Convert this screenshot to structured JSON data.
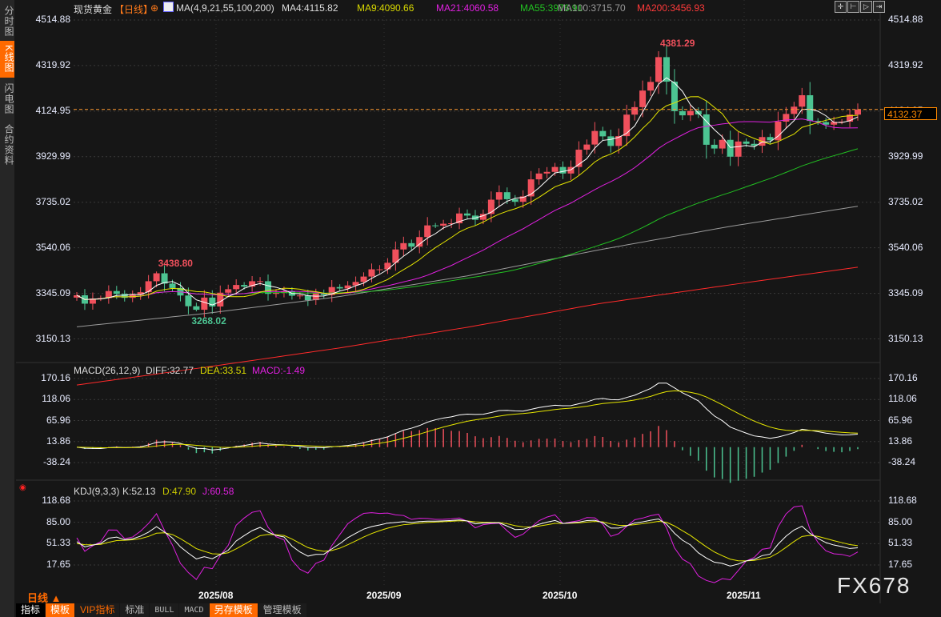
{
  "sidebar": {
    "items": [
      {
        "label": "分时图",
        "active": false
      },
      {
        "label": "K线图",
        "active": true
      },
      {
        "label": "闪电图",
        "active": false
      },
      {
        "label": "合约资料",
        "active": false
      }
    ]
  },
  "header": {
    "symbol": "现货黄金",
    "period": "【日线】",
    "ma_label": "MA(4,9,21,55,100,200)",
    "ma4": "MA4:4115.82",
    "ma9": "MA9:4090.66",
    "ma21": "MA21:4060.58",
    "ma55": "MA55:3976.91",
    "ma100": "MA100:3715.70",
    "ma200": "MA200:3456.93"
  },
  "top_tools": [
    "crosshair-icon",
    "zoom-in-icon",
    "zoom-out-icon",
    "move-right-icon"
  ],
  "current_price": "4132.37",
  "macd_header": {
    "label": "MACD(26,12,9)",
    "diff": "DIFF:32.77",
    "dea": "DEA:33.51",
    "macd": "MACD:-1.49"
  },
  "kdj_header": {
    "label": "KDJ(9,3,3)",
    "k": "K:52.13",
    "d": "D:47.90",
    "j": "J:60.58"
  },
  "period_selector": "日线 ▲",
  "toolbar": [
    "指标",
    "模板",
    "VIP指标",
    "标准",
    "BULL",
    "MACD",
    "另存模板",
    "管理模板"
  ],
  "watermark": "FX678",
  "colors": {
    "up": "#f0505c",
    "down": "#4cc492",
    "ma4": "#ffffff",
    "ma9": "#e6e600",
    "ma21": "#e020e0",
    "ma55": "#22c022",
    "ma100": "#9a9a9a",
    "ma200": "#ff2a2a",
    "accent": "#ff6a00"
  },
  "chart_data": [
    {
      "type": "candlestick",
      "x_months": [
        "2025/08",
        "2025/09",
        "2025/10",
        "2025/11"
      ],
      "y_ticks": [
        "4514.88",
        "4319.92",
        "4124.95",
        "3929.99",
        "3735.02",
        "3540.06",
        "3345.09",
        "3150.13"
      ],
      "ylim": [
        3052.6,
        4514.88
      ],
      "closes": [
        3337,
        3301,
        3323,
        3325,
        3355,
        3343,
        3326,
        3339,
        3350,
        3397,
        3431,
        3387,
        3368,
        3336,
        3290,
        3275,
        3327,
        3289,
        3348,
        3363,
        3381,
        3374,
        3397,
        3397,
        3343,
        3348,
        3354,
        3335,
        3336,
        3316,
        3345,
        3338,
        3372,
        3366,
        3379,
        3394,
        3417,
        3448,
        3448,
        3476,
        3533,
        3560,
        3545,
        3586,
        3636,
        3635,
        3643,
        3645,
        3687,
        3678,
        3660,
        3685,
        3746,
        3778,
        3748,
        3737,
        3760,
        3833,
        3858,
        3865,
        3886,
        3858,
        3886,
        3960,
        3982,
        4040,
        4017,
        3976,
        4018,
        4110,
        4142,
        4213,
        4250,
        4356,
        4251,
        4125,
        4107,
        4126,
        4111,
        3981,
        3965,
        4002,
        3930,
        3995,
        3985,
        3977,
        4014,
        4000,
        4080,
        4113,
        4144,
        4193,
        4083,
        4078,
        4067,
        4079,
        4080,
        4110,
        4132
      ],
      "annotations": [
        {
          "text": "3438.80",
          "value": 3438.8,
          "type": "high"
        },
        {
          "text": "3268.02",
          "value": 3268.02,
          "type": "low"
        },
        {
          "text": "4381.29",
          "value": 4381.29,
          "type": "high"
        }
      ],
      "ma100_line": [
        3202,
        3260,
        3330,
        3420,
        3530,
        3630,
        3718
      ],
      "ma200_line": [
        2953,
        3030,
        3110,
        3200,
        3300,
        3380,
        3457
      ]
    },
    {
      "type": "macd",
      "y_ticks": [
        "170.16",
        "118.06",
        "65.96",
        "13.86",
        "-38.24"
      ],
      "ylim": [
        -90,
        175
      ],
      "diff": 32.77,
      "dea": 33.51,
      "macd": -1.49
    },
    {
      "type": "kdj",
      "y_ticks": [
        "118.68",
        "85.00",
        "51.33",
        "17.65"
      ],
      "ylim": [
        -10,
        125
      ],
      "k": 52.13,
      "d": 47.9,
      "j": 60.58
    }
  ]
}
